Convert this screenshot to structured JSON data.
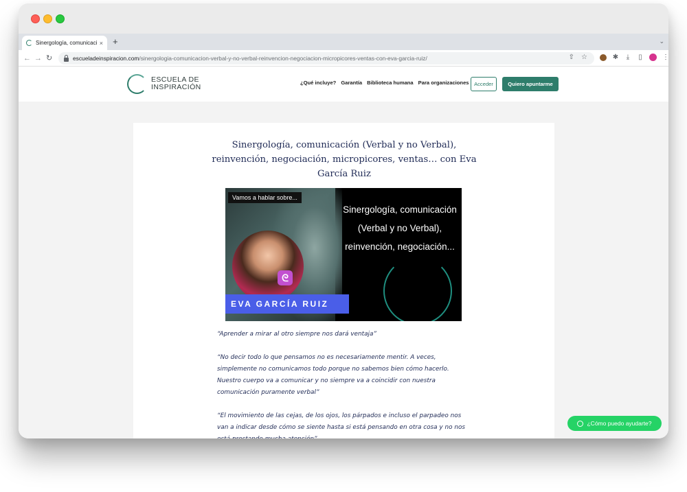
{
  "browser": {
    "tab_title": "Sinergología, comunicación (V",
    "tab_close": "×",
    "new_tab": "+",
    "tab_menu": "⌄",
    "url_host": "escueladeinspiracion.com",
    "url_path": "/sinergologia-comunicacion-verbal-y-no-verbal-reinvencion-negociacion-micropicores-ventas-con-eva-garcia-ruiz/",
    "back_icon": "←",
    "forward_icon": "→",
    "reload_icon": "↻",
    "share_icon": "⇧",
    "star_icon": "☆",
    "extensions_icon": "✱",
    "download_icon": "⤓",
    "sidepanel_icon": "▯",
    "menu_icon": "⋮"
  },
  "site": {
    "logo_line1": "ESCUELA DE",
    "logo_line2": "INSPIRACIÓN",
    "nav": [
      {
        "label": "¿Qué incluye?"
      },
      {
        "label": "Garantía"
      },
      {
        "label": "Biblioteca humana"
      },
      {
        "label": "Para organizaciones"
      }
    ],
    "login_label": "Acceder",
    "signup_label": "Quiero apuntarme"
  },
  "post": {
    "title": "Sinergología, comunicación (Verbal y no Verbal), reinvención, negociación, micropicores, ventas… con Eva García Ruiz",
    "hero": {
      "chip": "Vamos a hablar sobre...",
      "name": "EVA GARCÍA RUIZ",
      "text": "Sinergología, comunicación (Verbal y no Verbal), reinvención, negociación..."
    },
    "quotes": [
      "“Aprender a mirar al otro siempre nos dará ventaja”",
      "“No decir todo lo que pensamos no es necesariamente mentir. A veces, simplemente no comunicamos todo porque no sabemos bien cómo hacerlo. Nuestro cuerpo va a comunicar y no siempre va a coincidir con nuestra comunicación puramente verbal”",
      "“El movimiento de las cejas, de los ojos, los párpados e incluso el parpadeo nos van a indicar desde cómo se siente hasta si está pensando en otra cosa y no nos está prestando mucha atención”"
    ]
  },
  "whatsapp_label": "¿Cómo puedo ayudarte?",
  "colors": {
    "brand": "#2e7d6b",
    "title_text": "#1f2a55",
    "whatsapp": "#25d366"
  }
}
